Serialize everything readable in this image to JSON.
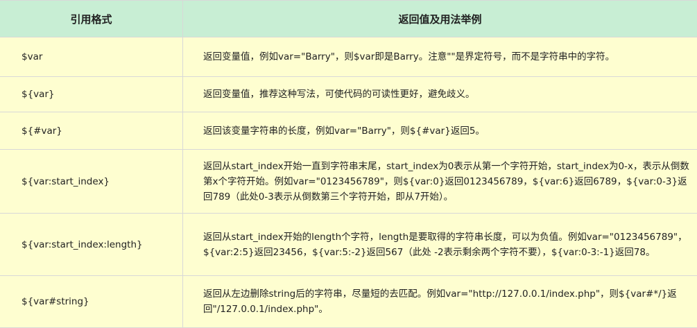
{
  "header": {
    "col_format": "引用格式",
    "col_desc": "返回值及用法举例"
  },
  "rows": [
    {
      "format": "$var",
      "desc": "返回变量值，例如var=\"Barry\"，则$var即是Barry。注意\"\"是界定符号，而不是字符串中的字符。"
    },
    {
      "format": "${var}",
      "desc": "返回变量值，推荐这种写法，可使代码的可读性更好，避免歧义。"
    },
    {
      "format": "${#var}",
      "desc": "返回该变量字符串的长度，例如var=\"Barry\"，则${#var}返回5。"
    },
    {
      "format": "${var:start_index}",
      "desc": "返回从start_index开始一直到字符串末尾，start_index为0表示从第一个字符开始，start_index为0-x，表示从倒数第x个字符开始。例如var=\"0123456789\"，则${var:0}返回0123456789，${var:6}返回6789，${var:0-3}返回789（此处0-3表示从倒数第三个字符开始，即从7开始）。"
    },
    {
      "format": "${var:start_index:length}",
      "desc": "返回从start_index开始的length个字符，length是要取得的字符串长度，可以为负值。例如var=\"0123456789\"，${var:2:5}返回23456，${var:5:-2}返回567（此处 -2表示剩余两个字符不要），${var:0-3:-1}返回78。"
    },
    {
      "format": "${var#string}",
      "desc": "返回从左边删除string后的字符串，尽量短的去匹配。例如var=\"http://127.0.0.1/index.php\"，则${var#*/}返回\"/127.0.0.1/index.php\"。"
    }
  ]
}
